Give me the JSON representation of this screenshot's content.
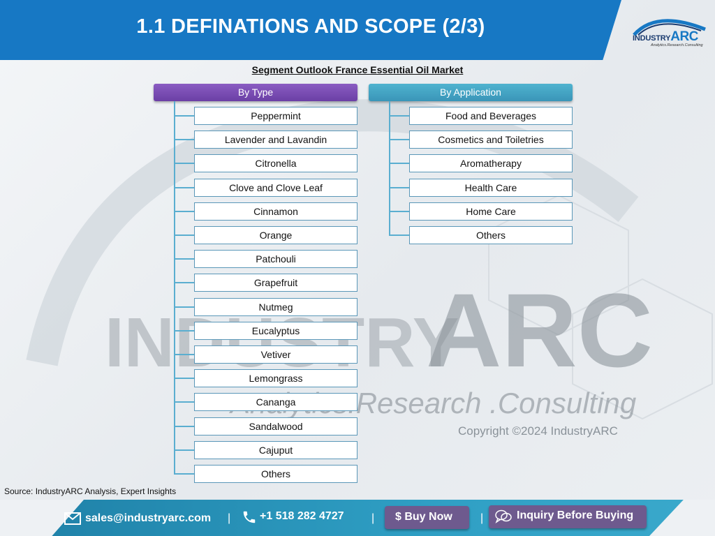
{
  "header": {
    "title": "1.1 DEFINATIONS AND SCOPE (2/3)"
  },
  "logo": {
    "line1": "INDUSTRY",
    "line2": "ARC",
    "tagline": "Analytics.Research.Consulting"
  },
  "watermark": {
    "brand_part1": "INDUSTRY",
    "brand_part2": "ARC",
    "tagline": "Analytics.Research .Consulting",
    "copyright": "Copyright ©2024 IndustryARC"
  },
  "diagram": {
    "title": "Segment Outlook France Essential Oil Market",
    "by_type": {
      "label": "By Type",
      "items": [
        "Peppermint",
        "Lavender and Lavandin",
        "Citronella",
        "Clove and Clove Leaf",
        "Cinnamon",
        "Orange",
        "Patchouli",
        "Grapefruit",
        "Nutmeg",
        "Eucalyptus",
        "Vetiver",
        "Lemongrass",
        "Cananga",
        "Sandalwood",
        "Cajuput",
        "Others"
      ]
    },
    "by_application": {
      "label": "By Application",
      "items": [
        "Food and Beverages",
        "Cosmetics and Toiletries",
        "Aromatherapy",
        "Health Care",
        "Home Care",
        "Others"
      ]
    }
  },
  "source": "Source: IndustryARC Analysis, Expert Insights",
  "footer": {
    "email": "sales@industryarc.com",
    "phone": "+1 518 282 4727",
    "separator": "|",
    "buy_now": "$ Buy Now",
    "inquiry": "Inquiry Before Buying"
  },
  "colors": {
    "header_blue": "#1778c4",
    "type_purple": "#6b3fa5",
    "application_teal": "#3a95b8",
    "footer_teal": "#2f9fc4",
    "button_purple": "#6e5a8e"
  }
}
